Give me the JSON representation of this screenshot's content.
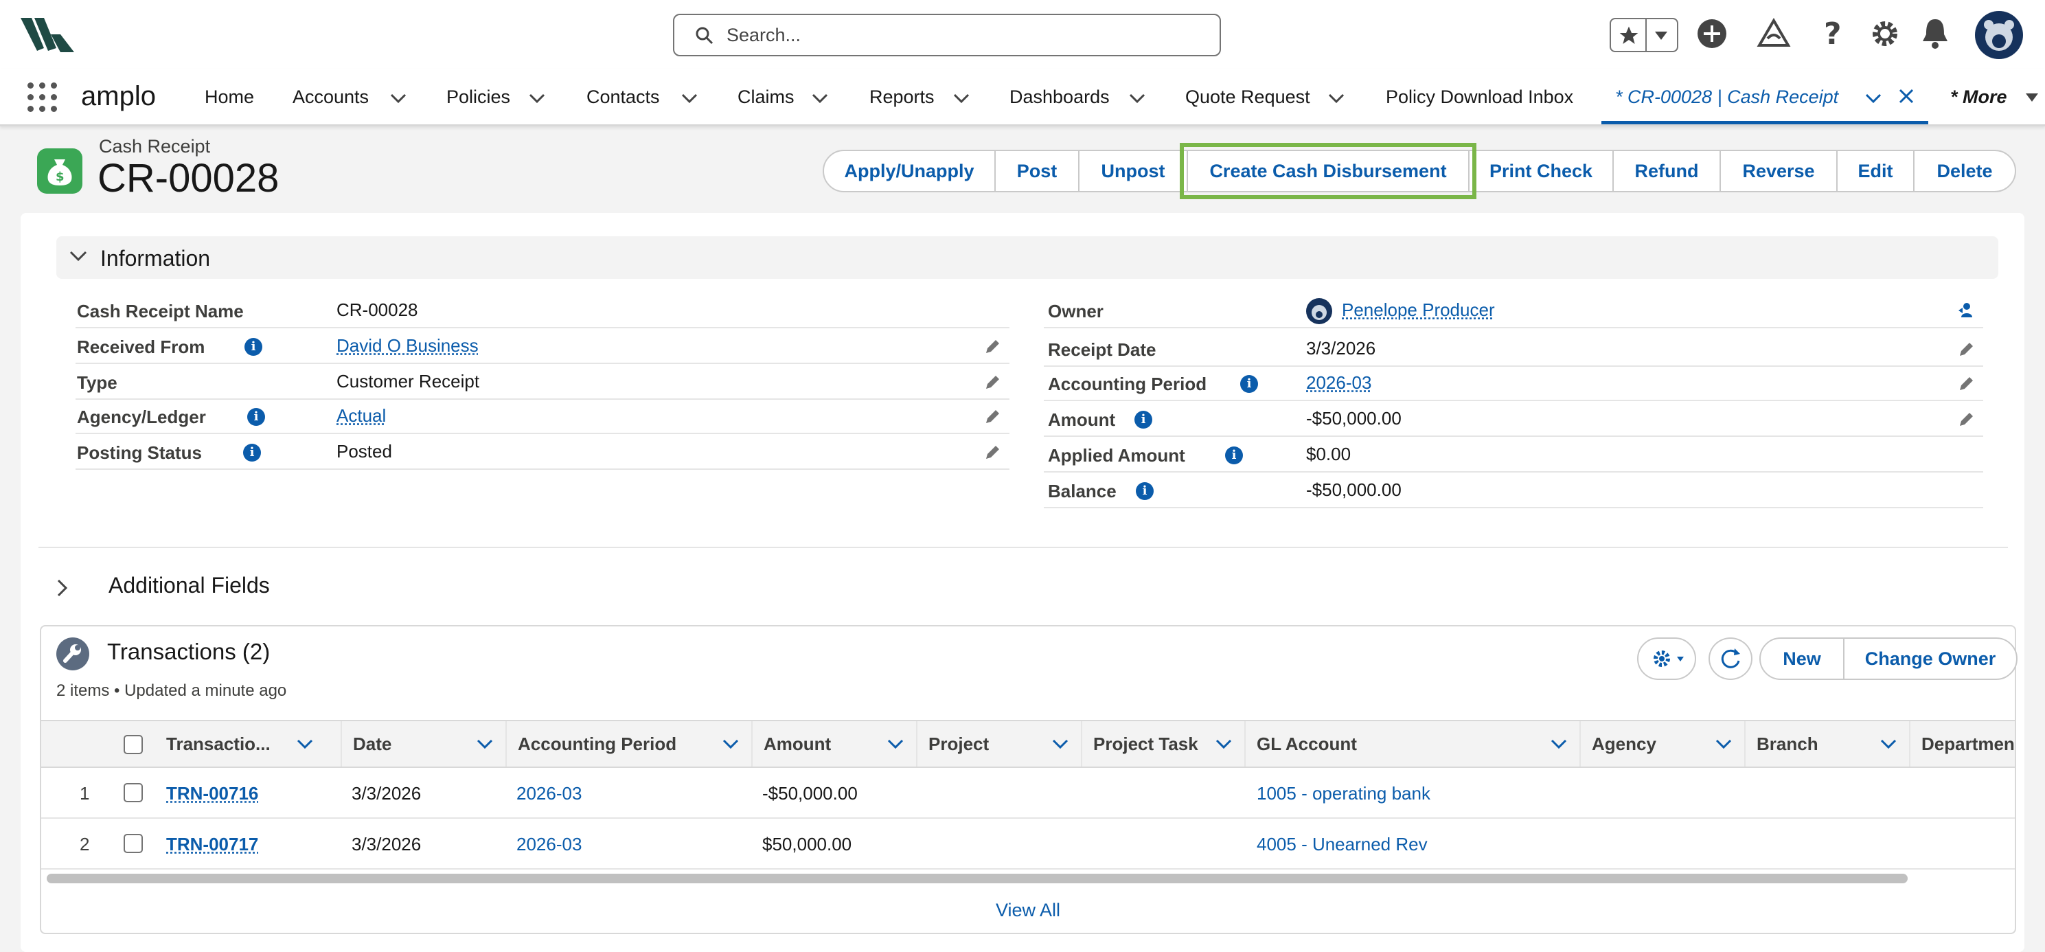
{
  "header": {
    "search_placeholder": "Search...",
    "icons": [
      "favorites-star-icon",
      "add-icon",
      "trailhead-icon",
      "help-icon",
      "setup-gear-icon",
      "notifications-bell-icon",
      "user-avatar-icon"
    ]
  },
  "nav": {
    "app_name": "amplo",
    "items": [
      {
        "label": "Home",
        "has_menu": false
      },
      {
        "label": "Accounts",
        "has_menu": true
      },
      {
        "label": "Policies",
        "has_menu": true
      },
      {
        "label": "Contacts",
        "has_menu": true
      },
      {
        "label": "Claims",
        "has_menu": true
      },
      {
        "label": "Reports",
        "has_menu": true
      },
      {
        "label": "Dashboards",
        "has_menu": true
      },
      {
        "label": "Quote Request",
        "has_menu": true
      },
      {
        "label": "Policy Download Inbox",
        "has_menu": false
      }
    ],
    "active_tab": "* CR-00028 | Cash Receipt",
    "more": "* More"
  },
  "record": {
    "type_label": "Cash Receipt",
    "title": "CR-00028",
    "actions": [
      "Apply/Unapply",
      "Post",
      "Unpost",
      "Create Cash Disbursement",
      "Print Check",
      "Refund",
      "Reverse",
      "Edit",
      "Delete"
    ],
    "highlighted_action": "Create Cash Disbursement"
  },
  "information": {
    "section_title": "Information",
    "left": [
      {
        "label": "Cash Receipt Name",
        "value": "CR-00028",
        "link": false,
        "info": false,
        "editable": false
      },
      {
        "label": "Received From",
        "value": "David O Business",
        "link": true,
        "info": true,
        "editable": true
      },
      {
        "label": "Type",
        "value": "Customer Receipt",
        "link": false,
        "info": false,
        "editable": true
      },
      {
        "label": "Agency/Ledger",
        "value": "Actual",
        "link": true,
        "info": true,
        "editable": true
      },
      {
        "label": "Posting Status",
        "value": "Posted",
        "link": false,
        "info": true,
        "editable": true
      }
    ],
    "right": [
      {
        "label": "Owner",
        "value": "Penelope Producer",
        "link": true,
        "info": false,
        "editable": false
      },
      {
        "label": "Receipt Date",
        "value": "3/3/2026",
        "link": false,
        "info": false,
        "editable": true
      },
      {
        "label": "Accounting Period",
        "value": "2026-03",
        "link": true,
        "info": true,
        "editable": true
      },
      {
        "label": "Amount",
        "value": "-$50,000.00",
        "link": false,
        "info": true,
        "editable": true
      },
      {
        "label": "Applied Amount",
        "value": "$0.00",
        "link": false,
        "info": true,
        "editable": false
      },
      {
        "label": "Balance",
        "value": "-$50,000.00",
        "link": false,
        "info": true,
        "editable": false
      }
    ]
  },
  "additional_fields": {
    "title": "Additional Fields"
  },
  "transactions": {
    "title": "Transactions (2)",
    "subtitle": "2 items • Updated a minute ago",
    "buttons": [
      "New",
      "Change Owner"
    ],
    "columns": [
      "Transactio...",
      "Date",
      "Accounting Period",
      "Amount",
      "Project",
      "Project Task",
      "GL Account",
      "Agency",
      "Branch",
      "Department"
    ],
    "rows": [
      {
        "num": "1",
        "transaction": "TRN-00716",
        "date": "3/3/2026",
        "period": "2026-03",
        "amount": "-$50,000.00",
        "project": "",
        "project_task": "",
        "gl_account": "1005 - operating bank",
        "agency": "",
        "branch": "",
        "department": ""
      },
      {
        "num": "2",
        "transaction": "TRN-00717",
        "date": "3/3/2026",
        "period": "2026-03",
        "amount": "$50,000.00",
        "project": "",
        "project_task": "",
        "gl_account": "4005 - Unearned Rev",
        "agency": "",
        "branch": "",
        "department": ""
      }
    ],
    "view_all": "View All"
  },
  "colors": {
    "brand_blue": "#0b5cab",
    "highlight_green": "#7ab648",
    "record_icon_green": "#3ba755"
  }
}
